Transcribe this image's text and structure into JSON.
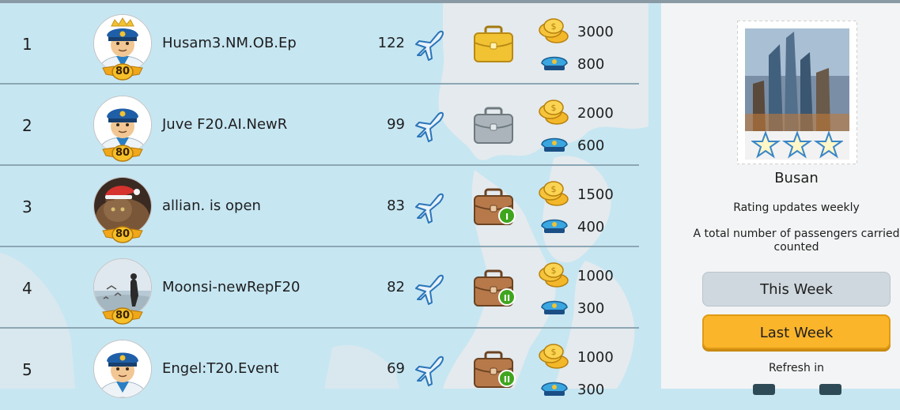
{
  "leaderboard": {
    "rows": [
      {
        "rank": "1",
        "name": "Husam3.NM.OB.Ep",
        "level": "80",
        "planes": "122",
        "case": "gold",
        "case_badge": "",
        "coins": "3000",
        "pilots": "800",
        "avatar": "pilot-crown"
      },
      {
        "rank": "2",
        "name": "Juve F20.AI.NewR",
        "level": "80",
        "planes": "99",
        "case": "silver",
        "case_badge": "",
        "coins": "2000",
        "pilots": "600",
        "avatar": "pilot"
      },
      {
        "rank": "3",
        "name": "allian. is open",
        "level": "80",
        "planes": "83",
        "case": "bronze",
        "case_badge": "I",
        "coins": "1500",
        "pilots": "400",
        "avatar": "cat-photo"
      },
      {
        "rank": "4",
        "name": "Moonsi-newRepF20",
        "level": "80",
        "planes": "82",
        "case": "bronze",
        "case_badge": "II",
        "coins": "1000",
        "pilots": "300",
        "avatar": "beach-photo"
      },
      {
        "rank": "5",
        "name": "Engel:T20.Event",
        "level": "80",
        "planes": "69",
        "case": "bronze",
        "case_badge": "II",
        "coins": "1000",
        "pilots": "300",
        "avatar": "pilot"
      }
    ]
  },
  "panel": {
    "city": "Busan",
    "stars": 3,
    "rating_note": "Rating updates weekly",
    "passengers_note": "A total number of passengers carried",
    "passengers_note_2": "counted",
    "this_week": "This Week",
    "last_week": "Last Week",
    "refresh_label": "Refresh in"
  },
  "colors": {
    "accent": "#fbb52b",
    "map_water": "#c6e6f2",
    "map_land": "#e6ecef",
    "panel_bg": "#f3f4f5",
    "badge_green": "#3fa51e"
  },
  "icons": {
    "plane": "plane-icon",
    "coin": "coin-stack-icon",
    "cap": "pilot-cap-icon",
    "case": "briefcase-icon",
    "level": "level-wings-badge-icon"
  }
}
